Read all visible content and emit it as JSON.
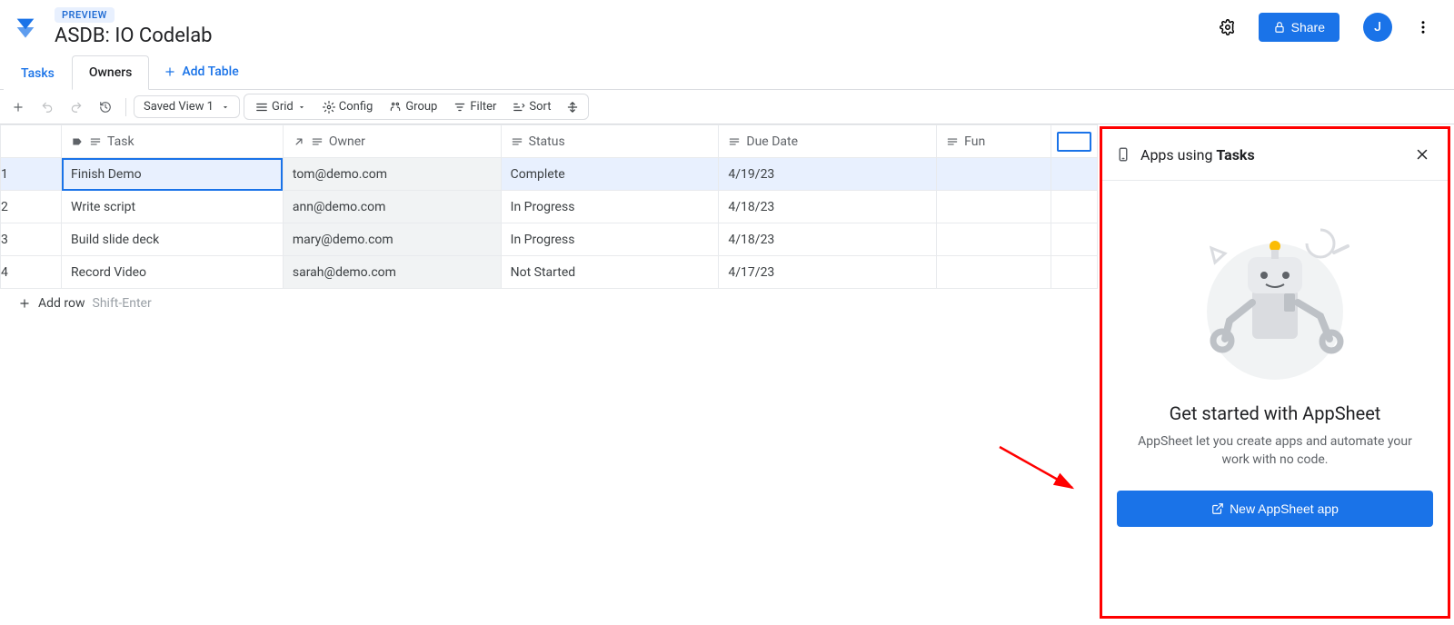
{
  "header": {
    "preview_badge": "PREVIEW",
    "title": "ASDB: IO Codelab",
    "share_label": "Share",
    "avatar_initial": "J"
  },
  "tabs": {
    "items": [
      {
        "label": "Tasks",
        "active": true
      },
      {
        "label": "Owners",
        "active": false
      }
    ],
    "add_table_label": "Add Table"
  },
  "toolbar": {
    "saved_view_label": "Saved View 1",
    "grid_label": "Grid",
    "config_label": "Config",
    "group_label": "Group",
    "filter_label": "Filter",
    "sort_label": "Sort"
  },
  "table": {
    "columns": [
      {
        "key": "task",
        "label": "Task",
        "type": "text",
        "has_label_icon": true
      },
      {
        "key": "owner",
        "label": "Owner",
        "type": "ref"
      },
      {
        "key": "status",
        "label": "Status",
        "type": "text"
      },
      {
        "key": "due_date",
        "label": "Due Date",
        "type": "text"
      },
      {
        "key": "fun",
        "label": "Fun",
        "type": "text"
      }
    ],
    "rows": [
      {
        "num": "1",
        "task": "Finish Demo",
        "owner": "tom@demo.com",
        "status": "Complete",
        "due_date": "4/19/23",
        "fun": "",
        "selected": true
      },
      {
        "num": "2",
        "task": "Write script",
        "owner": "ann@demo.com",
        "status": "In Progress",
        "due_date": "4/18/23",
        "fun": ""
      },
      {
        "num": "3",
        "task": "Build slide deck",
        "owner": "mary@demo.com",
        "status": "In Progress",
        "due_date": "4/18/23",
        "fun": ""
      },
      {
        "num": "4",
        "task": "Record Video",
        "owner": "sarah@demo.com",
        "status": "Not Started",
        "due_date": "4/17/23",
        "fun": ""
      }
    ],
    "add_row_label": "Add row",
    "add_row_shortcut": "Shift-Enter"
  },
  "side_panel": {
    "title_prefix": "Apps using ",
    "title_bold": "Tasks",
    "heading": "Get started with AppSheet",
    "description": "AppSheet let you create apps and automate your work with no code.",
    "button_label": "New AppSheet app"
  }
}
